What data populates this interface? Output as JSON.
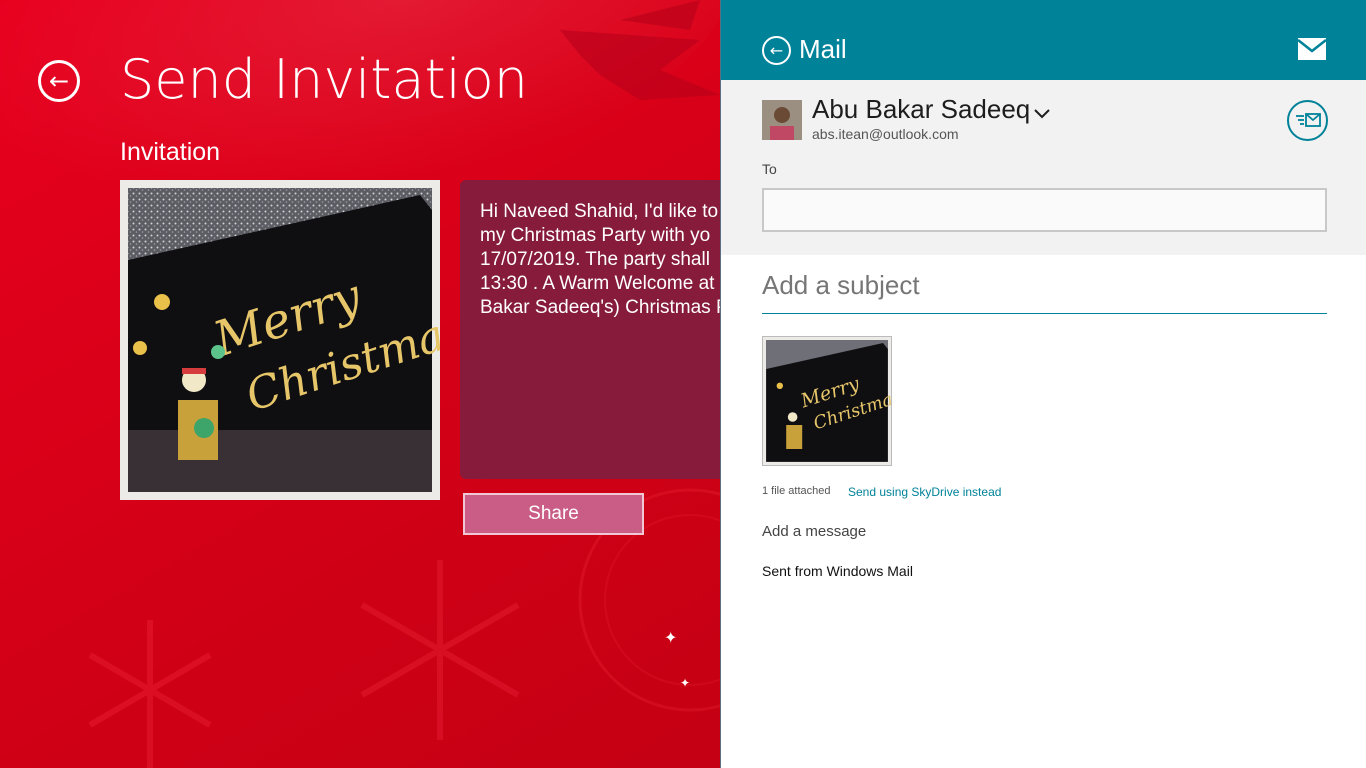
{
  "app": {
    "title": "Send Invitation",
    "section_title": "Invitation",
    "message_text": "Hi Naveed Shahid, I'd like to\nmy Christmas Party with yo\n17/07/2019. The party shall\n13:30 . A Warm Welcome at\nBakar Sadeeq's) Christmas P",
    "share_label": "Share",
    "card": {
      "line1": "Merry",
      "line2": "Christmas"
    },
    "colors": {
      "background": "#d8001c",
      "message_box": "#861b3b",
      "share_button": "#c95d86"
    }
  },
  "mail": {
    "title": "Mail",
    "sender_name": "Abu Bakar Sadeeq",
    "sender_email": "abs.itean@outlook.com",
    "to_label": "To",
    "to_value": "",
    "subject_placeholder": "Add a subject",
    "attachment_count": "1 file attached",
    "skydrive_link": "Send using SkyDrive instead",
    "message_placeholder": "Add a message",
    "signature": "Sent from Windows Mail",
    "colors": {
      "accent": "#008299",
      "header_bg": "#008299",
      "compose_bg": "#f2f2f2"
    }
  }
}
